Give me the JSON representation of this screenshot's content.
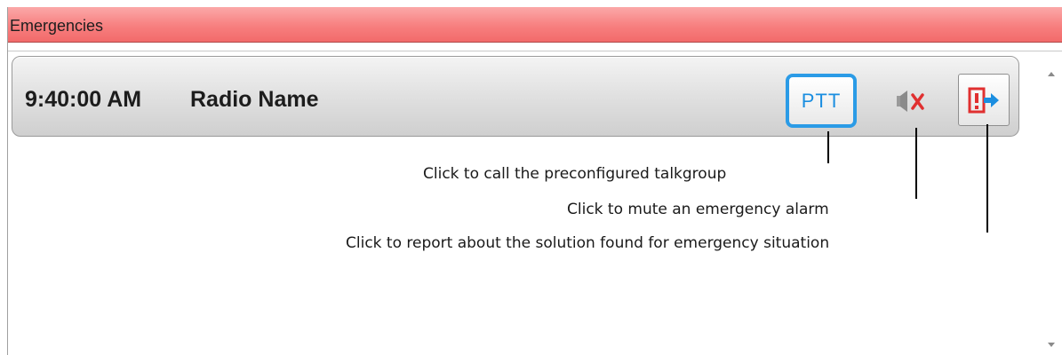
{
  "panel": {
    "title": "Emergencies"
  },
  "emergency": {
    "time": "9:40:00 AM",
    "radio_name": "Radio Name",
    "ptt_label": "PTT",
    "mute_icon": "speaker-muted-icon",
    "solution_icon": "exclamation-exit-icon"
  },
  "callouts": {
    "ptt": "Click to call the preconfigured talkgroup",
    "mute": "Click to mute an emergency alarm",
    "solution": "Click to report about the solution found for emergency situation"
  },
  "colors": {
    "header_bg": "#f77f7f",
    "ptt_accent": "#2b9be6",
    "mute_x": "#e03030",
    "solution_red": "#e03030",
    "solution_arrow": "#1b8ee0"
  }
}
